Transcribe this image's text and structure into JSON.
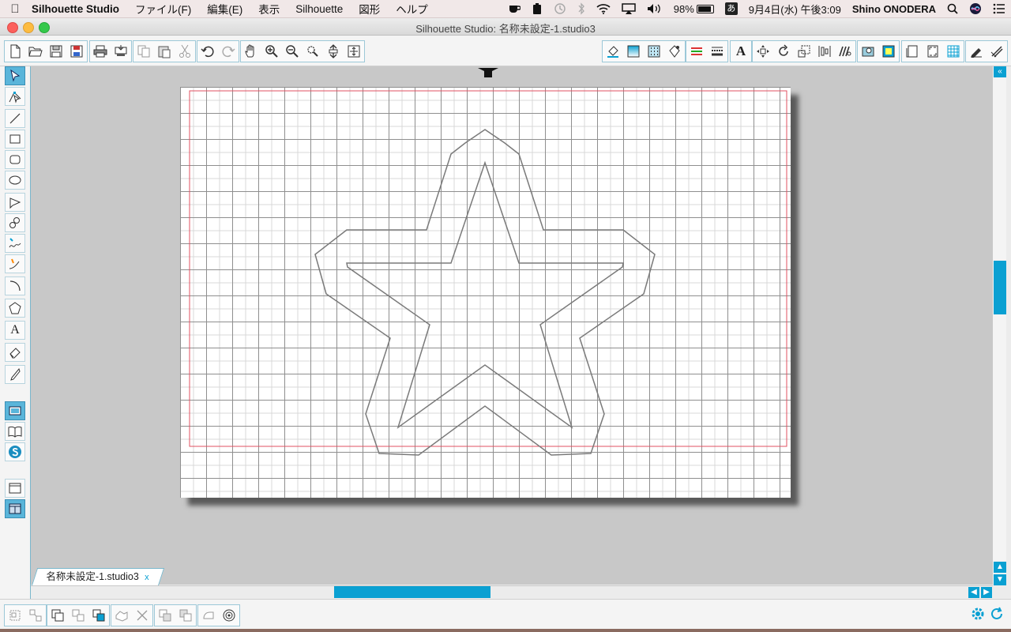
{
  "menubar": {
    "app_name": "Silhouette Studio",
    "menus": [
      "ファイル(F)",
      "編集(E)",
      "表示",
      "Silhouette",
      "図形",
      "ヘルプ"
    ],
    "battery": "98%",
    "datetime": "9月4日(水) 午後3:09",
    "user": "Shino ONODERA",
    "input_method": "あ"
  },
  "window": {
    "title": "Silhouette Studio: 名称未設定-1.studio3"
  },
  "document_tab": {
    "name": "名称未設定-1.studio3",
    "close": "x"
  },
  "colors": {
    "accent": "#0aa0d2",
    "cut_border": "#e05060",
    "shape_stroke": "#7a7a7a"
  },
  "toolbar_left_icons": [
    "new-icon",
    "open-icon",
    "save-icon",
    "save-library-icon",
    "print-icon",
    "send-icon",
    "copy-icon",
    "paste-icon",
    "cut-icon",
    "undo-icon",
    "redo-icon",
    "pan-icon",
    "zoom-in-icon",
    "zoom-out-icon",
    "zoom-select-icon",
    "zoom-drag-icon",
    "fit-page-icon"
  ],
  "toolbar_right_icons": [
    "fill-color-icon",
    "fill-gradient-icon",
    "fill-pattern-icon",
    "line-color-icon",
    "line-style-icon",
    "line-weight-icon",
    "text-style-icon",
    "transform-icon",
    "rotate-icon",
    "scale-icon",
    "align-icon",
    "replicate-icon",
    "trace-icon",
    "cut-settings-icon",
    "page-settings-icon",
    "design-view-icon",
    "registration-icon",
    "grid-icon",
    "sketch-icon",
    "library-icon"
  ],
  "left_tools": [
    "select-tool-icon",
    "edit-points-icon",
    "line-tool-icon",
    "rectangle-tool-icon",
    "rounded-rect-tool-icon",
    "ellipse-tool-icon",
    "polygon-tool-icon",
    "curve-tool-icon",
    "freehand-tool-icon",
    "smooth-freehand-tool-icon",
    "arc-tool-icon",
    "regular-polygon-tool-icon",
    "text-tool-icon",
    "eraser-tool-icon",
    "knife-tool-icon",
    "design-area-icon",
    "library-icon",
    "silhouette-store-icon",
    "single-view-icon",
    "split-view-icon"
  ],
  "bottom_tools": [
    "group-icon",
    "ungroup-icon",
    "compound-icon",
    "release-compound-icon",
    "bring-front-icon",
    "weld-icon",
    "subtract-icon",
    "intersect-icon",
    "crop-icon",
    "offset-icon",
    "internal-offset-icon"
  ],
  "text_tool_glyph": "A",
  "text_toolbar_glyph": "A"
}
